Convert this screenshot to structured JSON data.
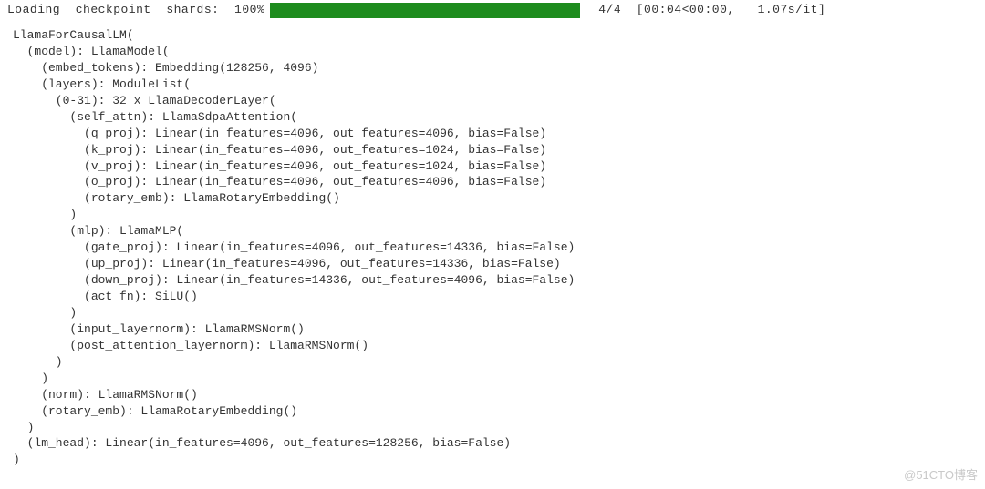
{
  "progress": {
    "label": "Loading  checkpoint  shards:  100%",
    "stats": "4/4  [00:04<00:00,   1.07s/it]"
  },
  "code": {
    "text": "LlamaForCausalLM(\n  (model): LlamaModel(\n    (embed_tokens): Embedding(128256, 4096)\n    (layers): ModuleList(\n      (0-31): 32 x LlamaDecoderLayer(\n        (self_attn): LlamaSdpaAttention(\n          (q_proj): Linear(in_features=4096, out_features=4096, bias=False)\n          (k_proj): Linear(in_features=4096, out_features=1024, bias=False)\n          (v_proj): Linear(in_features=4096, out_features=1024, bias=False)\n          (o_proj): Linear(in_features=4096, out_features=4096, bias=False)\n          (rotary_emb): LlamaRotaryEmbedding()\n        )\n        (mlp): LlamaMLP(\n          (gate_proj): Linear(in_features=4096, out_features=14336, bias=False)\n          (up_proj): Linear(in_features=4096, out_features=14336, bias=False)\n          (down_proj): Linear(in_features=14336, out_features=4096, bias=False)\n          (act_fn): SiLU()\n        )\n        (input_layernorm): LlamaRMSNorm()\n        (post_attention_layernorm): LlamaRMSNorm()\n      )\n    )\n    (norm): LlamaRMSNorm()\n    (rotary_emb): LlamaRotaryEmbedding()\n  )\n  (lm_head): Linear(in_features=4096, out_features=128256, bias=False)\n)"
  },
  "watermark": "@51CTO博客"
}
